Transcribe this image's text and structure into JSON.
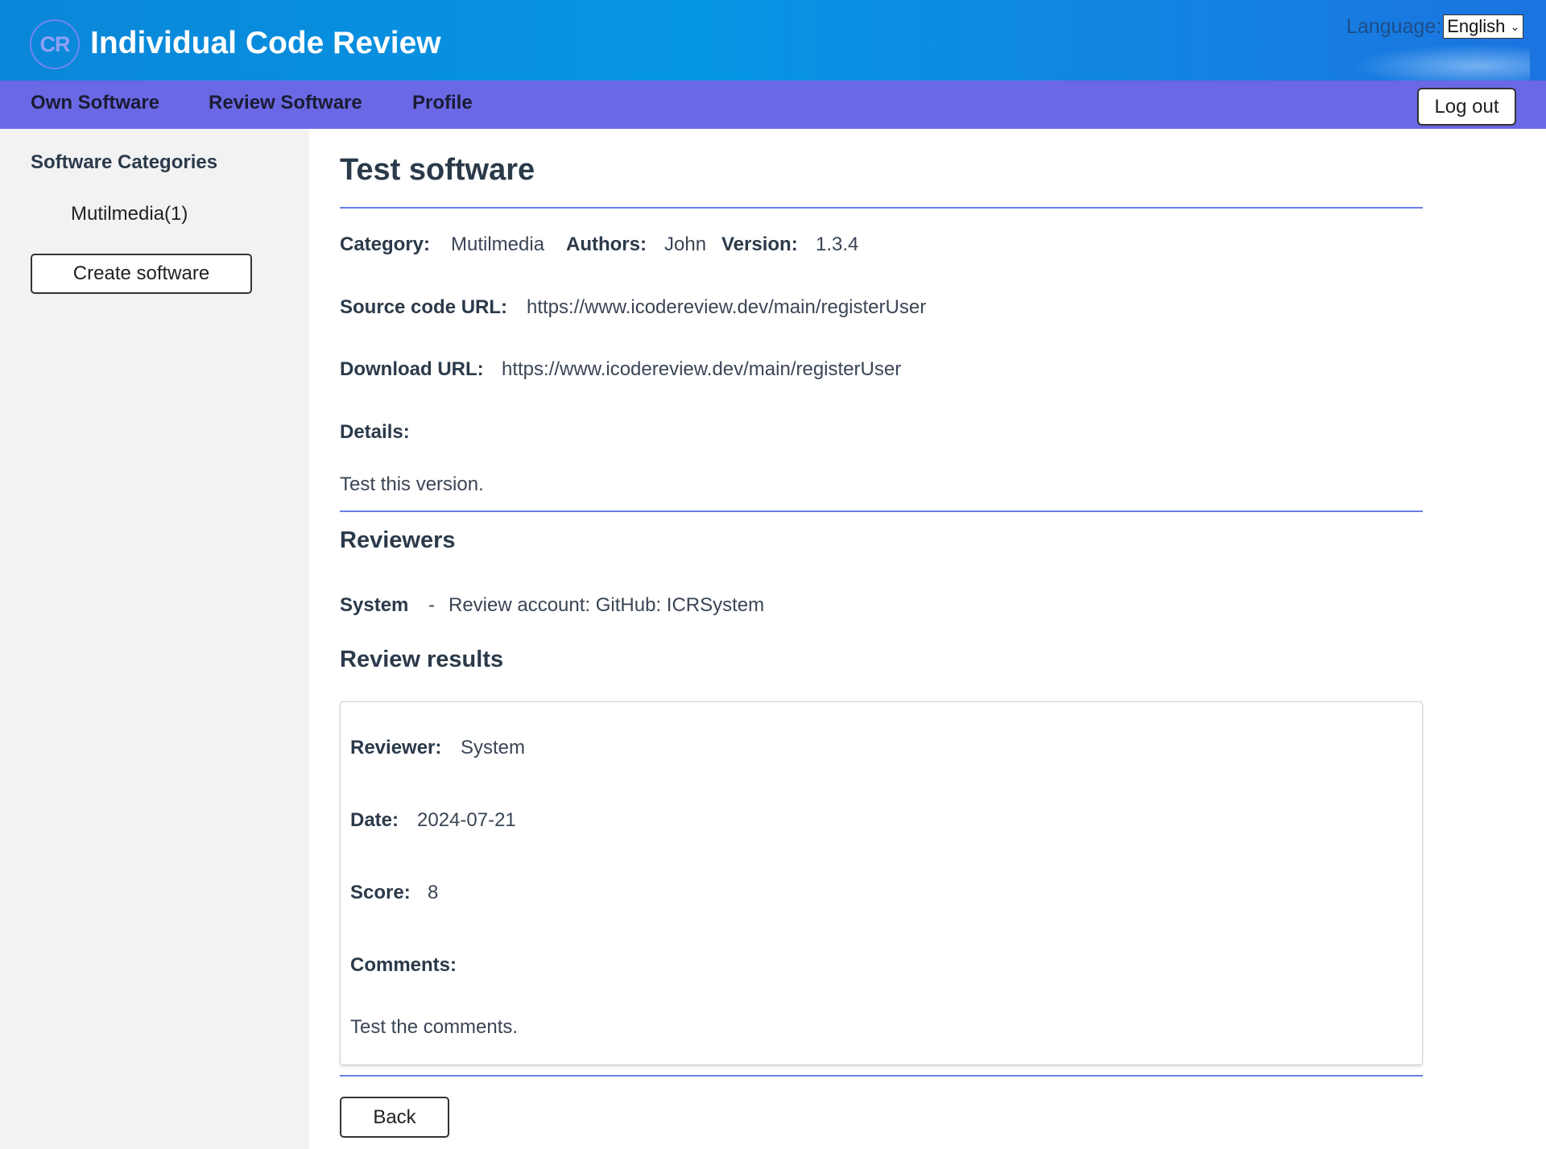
{
  "header": {
    "logo_text": "CR",
    "app_title": "Individual Code Review",
    "language_label": "Language:",
    "language_selected": "English"
  },
  "nav": {
    "items": [
      {
        "label": "Own Software"
      },
      {
        "label": "Review Software"
      },
      {
        "label": "Profile"
      }
    ],
    "logout_label": "Log out"
  },
  "sidebar": {
    "title": "Software Categories",
    "categories": [
      {
        "label": "Mutilmedia(1)"
      }
    ],
    "create_label": "Create software"
  },
  "software": {
    "title": "Test software",
    "category_label": "Category:",
    "category": "Mutilmedia",
    "authors_label": "Authors:",
    "authors": "John",
    "version_label": "Version:",
    "version": "1.3.4",
    "source_label": "Source code URL:",
    "source_url": "https://www.icodereview.dev/main/registerUser",
    "download_label": "Download URL:",
    "download_url": "https://www.icodereview.dev/main/registerUser",
    "details_label": "Details:",
    "details": "Test this version."
  },
  "reviewers": {
    "heading": "Reviewers",
    "items": [
      {
        "name": "System",
        "separator": "-",
        "account": "Review account: GitHub: ICRSystem"
      }
    ]
  },
  "results": {
    "heading": "Review results",
    "reviewer_label": "Reviewer:",
    "reviewer": "System",
    "date_label": "Date:",
    "date": "2024-07-21",
    "score_label": "Score:",
    "score": "8",
    "comments_label": "Comments:",
    "comments": "Test the comments."
  },
  "back_label": "Back",
  "colors": {
    "header": "#0796e4",
    "navbar": "#6b68e5",
    "divider": "#6b7fe8",
    "sidebar": "#f2f2f2"
  }
}
